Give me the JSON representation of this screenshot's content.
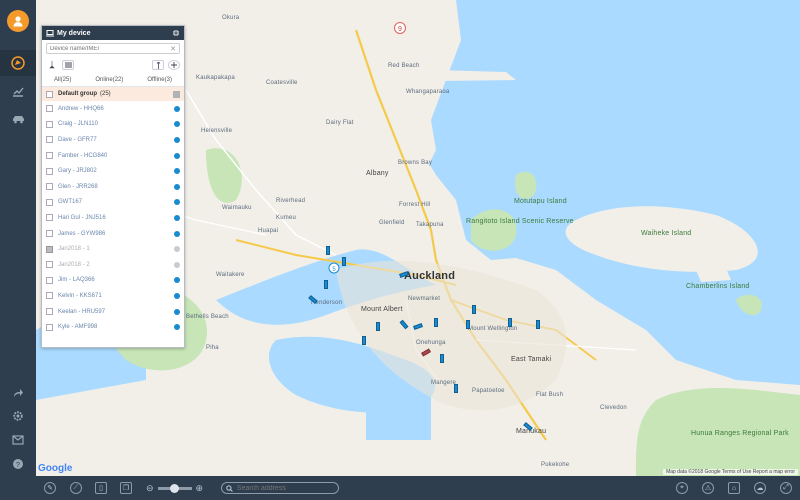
{
  "panel": {
    "title": "My device",
    "search_placeholder": "Device name/IMEI",
    "tabs": [
      "All(25)",
      "Online(22)",
      "Offline(3)"
    ],
    "group_label": "Default group",
    "group_count": "(25)",
    "devices": [
      {
        "name": "Andrew - HHQ66",
        "online": true
      },
      {
        "name": "Craig - JLN110",
        "online": true
      },
      {
        "name": "Dave - GFR77",
        "online": true
      },
      {
        "name": "Famber - HCG840",
        "online": true
      },
      {
        "name": "Gary - JRJ802",
        "online": true
      },
      {
        "name": "Glen - JRR268",
        "online": true
      },
      {
        "name": "GWT167",
        "online": true
      },
      {
        "name": "Hari Gul - JNJ516",
        "online": true
      },
      {
        "name": "James - GYW986",
        "online": true
      },
      {
        "name": "Jan2018 - 1",
        "online": false
      },
      {
        "name": "Jan2018 - 2",
        "online": false
      },
      {
        "name": "Jim - LAQ366",
        "online": true
      },
      {
        "name": "Kelvin - KKS671",
        "online": true
      },
      {
        "name": "Keelan - HRU597",
        "online": true
      },
      {
        "name": "Kyle - AMF998",
        "online": true
      }
    ]
  },
  "map": {
    "places": [
      "Okura",
      "Kaukapakapa",
      "Coatesville",
      "Helensville",
      "Dairy Flat",
      "Red Beach",
      "Whangaparaoa",
      "Albany",
      "Riverhead",
      "Kumeu",
      "Waimauku",
      "Huapai",
      "Glenfield",
      "Takapuna",
      "Forrest Hill",
      "Browns Bay",
      "Auckland",
      "Newmarket",
      "Mount Albert",
      "Henderson",
      "Mount Wellington",
      "East Tamaki",
      "Onehunga",
      "Mangere",
      "Papatoetoe",
      "Manukau",
      "Flat Bush",
      "Clevedon",
      "Pukekohe",
      "Bethells Beach",
      "Piha",
      "Waitakere"
    ],
    "green_labels": [
      "Motutapu Island",
      "Rangitoto Island Scenic Reserve",
      "Waiheke Island",
      "Chamberlins Island",
      "Hunua Ranges Regional Park"
    ],
    "logo": "Google",
    "footer": "Map data ©2018 Google   Terms of Use   Report a map error"
  },
  "bottombar": {
    "address_placeholder": "Search address"
  },
  "colors": {
    "sidebar": "#2f3e4e",
    "avatar": "#f39a2b",
    "vehicle": "#1a8bd0",
    "water": "#aadaff",
    "land": "#f2efe9",
    "park": "#c7e5b7"
  }
}
